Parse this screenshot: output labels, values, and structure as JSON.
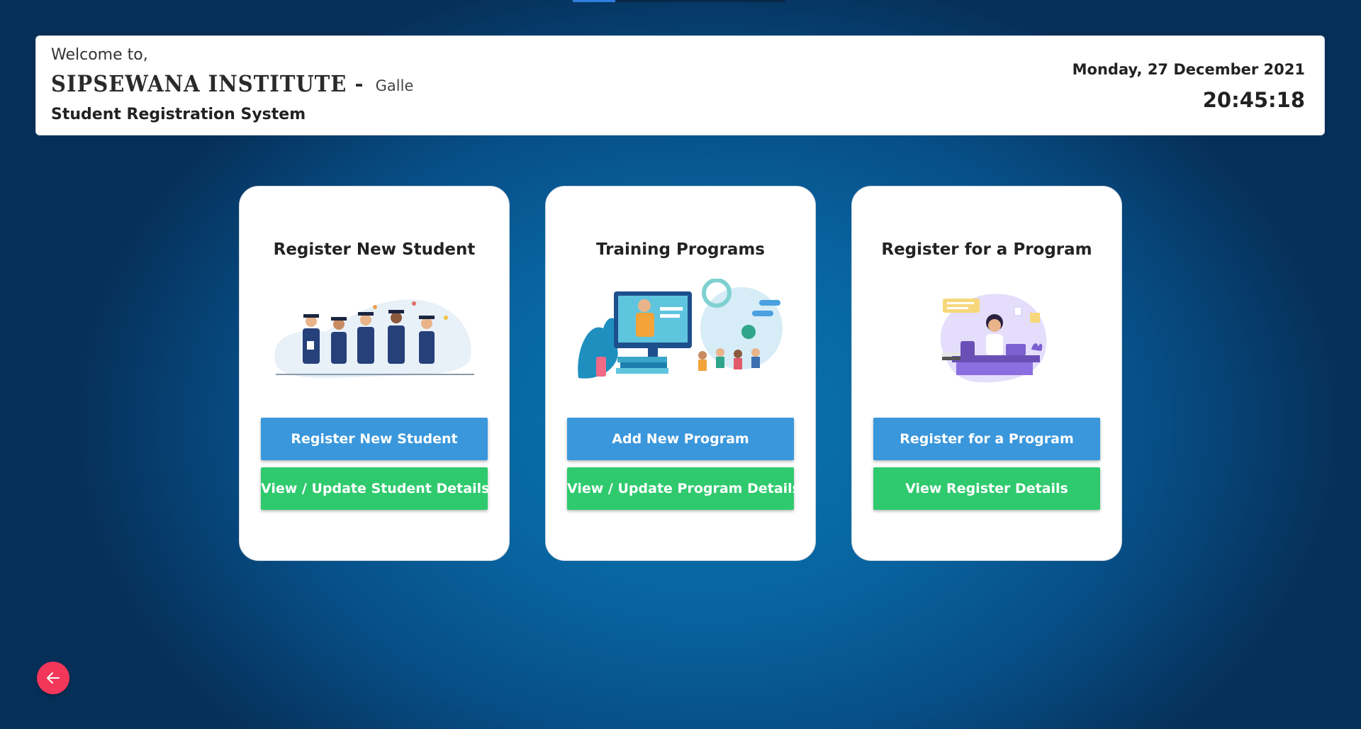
{
  "header": {
    "welcome": "Welcome to,",
    "institute_name": "SIPSEWANA INSTITUTE",
    "institute_dash": "-",
    "institute_city": "Galle",
    "system_title": "Student Registration System",
    "date": "Monday, 27 December 2021",
    "time": "20:45:18"
  },
  "cards": [
    {
      "title": "Register New Student",
      "illustration": "graduates-illustration",
      "primary_button": "Register New Student",
      "secondary_button": "View / Update Student Details"
    },
    {
      "title": "Training Programs",
      "illustration": "online-training-illustration",
      "primary_button": "Add New Program",
      "secondary_button": "View / Update Program Details"
    },
    {
      "title": "Register for a Program",
      "illustration": "student-at-desk-illustration",
      "primary_button": "Register for a Program",
      "secondary_button": "View Register Details"
    }
  ],
  "back_button": {
    "icon": "arrow-left-icon"
  },
  "colors": {
    "primary_button": "#3a97dc",
    "secondary_button": "#2fca6e",
    "back_button": "#f2375a",
    "background": "#0864a0"
  }
}
